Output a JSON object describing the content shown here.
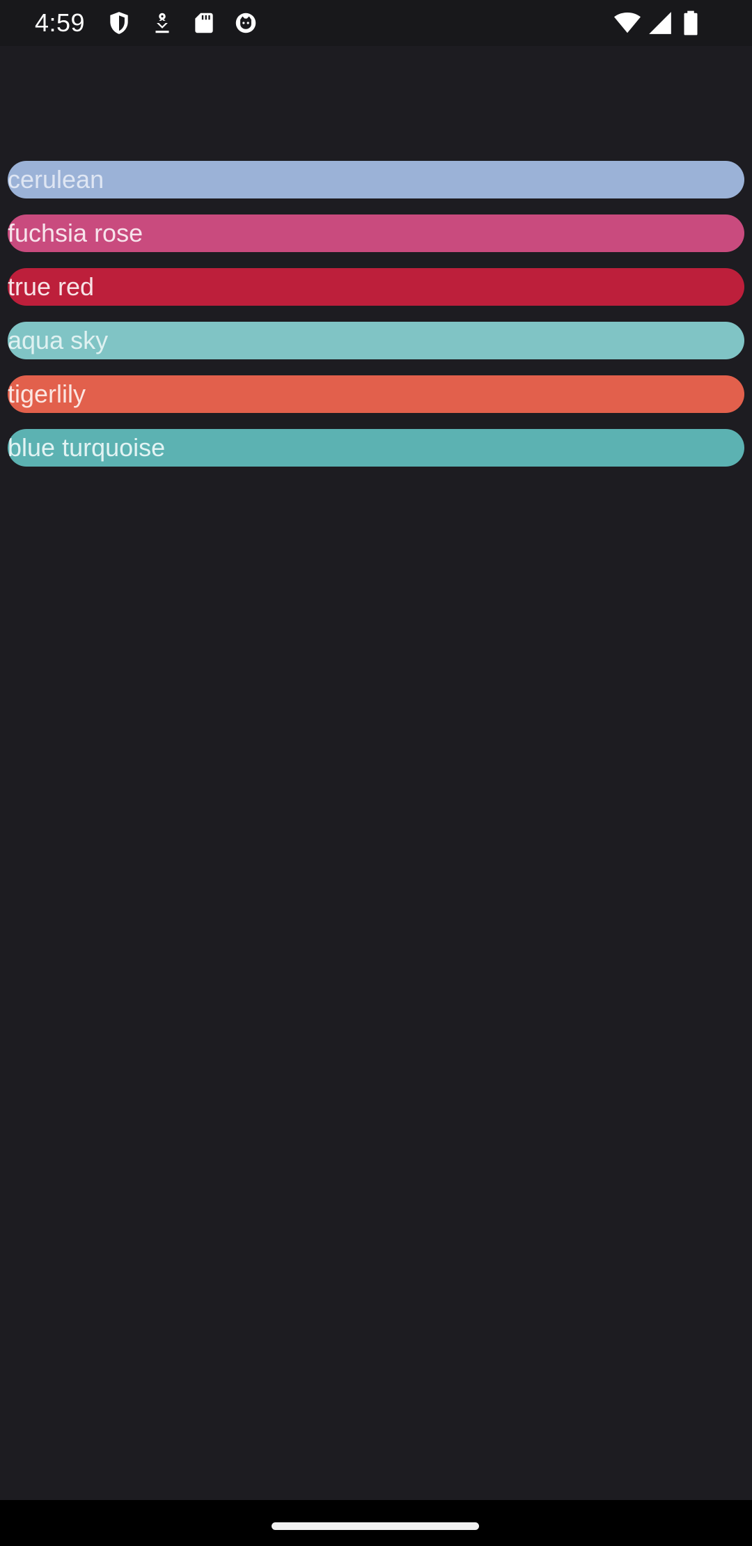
{
  "status_bar": {
    "time": "4:59",
    "left_icons": [
      "shield-icon",
      "download-icon",
      "sd-card-icon",
      "cat-face-icon"
    ],
    "right_icons": [
      "wifi-icon",
      "cellular-signal-icon",
      "battery-icon"
    ]
  },
  "colors": [
    {
      "label": "cerulean",
      "bg": "#9bb2d7",
      "fg": "#dfe6f3"
    },
    {
      "label": "fuchsia rose",
      "bg": "#c94b7e",
      "fg": "#f7e4ec"
    },
    {
      "label": "true red",
      "bg": "#bd1f3b",
      "fg": "#f7e2e6"
    },
    {
      "label": "aqua sky",
      "bg": "#80c4c5",
      "fg": "#dff1f1"
    },
    {
      "label": "tigerlily",
      "bg": "#e2604c",
      "fg": "#fbe6e2"
    },
    {
      "label": "blue turquoise",
      "bg": "#5cb2b2",
      "fg": "#e2f3f3"
    }
  ]
}
